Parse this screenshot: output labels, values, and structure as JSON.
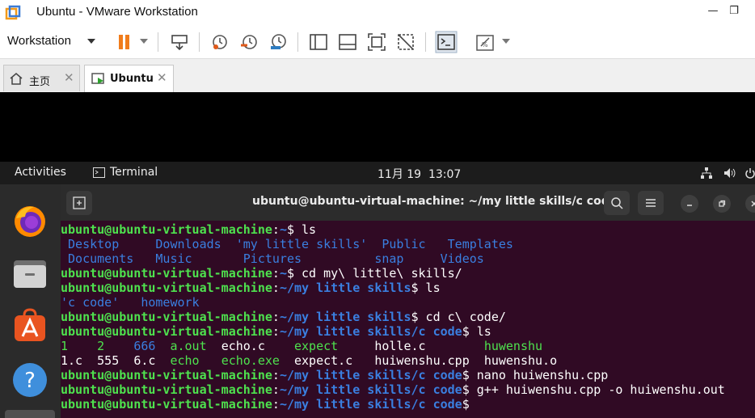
{
  "window": {
    "title": "Ubuntu - VMware Workstation"
  },
  "toolbar": {
    "menu_label": "Workstation"
  },
  "tabs": [
    {
      "label": "主页"
    },
    {
      "label": "Ubuntu"
    }
  ],
  "ubuntu_topbar": {
    "activities": "Activities",
    "app": "Terminal",
    "datetime": "11月 19  13:07"
  },
  "terminal": {
    "title": "ubuntu@ubuntu-virtual-machine: ~/my little skills/c code",
    "lines": [
      {
        "user": "ubuntu@ubuntu-virtual-machine",
        "sep": ":",
        "path": "~",
        "cmd": "$ ls"
      },
      {
        "out": [
          {
            "t": " Desktop     ",
            "c": "blue"
          },
          {
            "t": "Downloads  ",
            "c": "blue"
          },
          {
            "t": "'my little skills'  ",
            "c": "blue"
          },
          {
            "t": "Public   ",
            "c": "blue"
          },
          {
            "t": "Templates",
            "c": "blue"
          }
        ]
      },
      {
        "out": [
          {
            "t": " Documents   ",
            "c": "blue"
          },
          {
            "t": "Music      ",
            "c": "blue"
          },
          {
            "t": " Pictures          ",
            "c": "blue"
          },
          {
            "t": "snap     ",
            "c": "blue"
          },
          {
            "t": "Videos",
            "c": "blue"
          }
        ]
      },
      {
        "user": "ubuntu@ubuntu-virtual-machine",
        "sep": ":",
        "path": "~",
        "cmd": "$ cd my\\ little\\ skills/"
      },
      {
        "user": "ubuntu@ubuntu-virtual-machine",
        "sep": ":",
        "path": "~/my little skills",
        "cmd": "$ ls"
      },
      {
        "out": [
          {
            "t": "'c code'   ",
            "c": "blue"
          },
          {
            "t": "homework",
            "c": "blue"
          }
        ]
      },
      {
        "user": "ubuntu@ubuntu-virtual-machine",
        "sep": ":",
        "path": "~/my little skills",
        "cmd": "$ cd c\\ code/"
      },
      {
        "user": "ubuntu@ubuntu-virtual-machine",
        "sep": ":",
        "path": "~/my little skills/c code",
        "cmd": "$ ls"
      },
      {
        "out": [
          {
            "t": "1    ",
            "c": "green"
          },
          {
            "t": "2    ",
            "c": "green"
          },
          {
            "t": "666  ",
            "c": "blue"
          },
          {
            "t": "a.out  ",
            "c": "green"
          },
          {
            "t": "echo.c    ",
            "c": "white"
          },
          {
            "t": "expect     ",
            "c": "green"
          },
          {
            "t": "holle.c        ",
            "c": "white"
          },
          {
            "t": "huwenshu",
            "c": "green"
          }
        ]
      },
      {
        "out": [
          {
            "t": "1.c  ",
            "c": "white"
          },
          {
            "t": "555  ",
            "c": "white"
          },
          {
            "t": "6.c  ",
            "c": "white"
          },
          {
            "t": "echo   ",
            "c": "green"
          },
          {
            "t": "echo.exe  ",
            "c": "green"
          },
          {
            "t": "expect.c   ",
            "c": "white"
          },
          {
            "t": "huiwenshu.cpp  ",
            "c": "white"
          },
          {
            "t": "huwenshu.o",
            "c": "white"
          }
        ]
      },
      {
        "user": "ubuntu@ubuntu-virtual-machine",
        "sep": ":",
        "path": "~/my little skills/c code",
        "cmd": "$ nano huiwenshu.cpp"
      },
      {
        "user": "ubuntu@ubuntu-virtual-machine",
        "sep": ":",
        "path": "~/my little skills/c code",
        "cmd": "$ g++ huiwenshu.cpp -o huiwenshu.out"
      },
      {
        "user": "ubuntu@ubuntu-virtual-machine",
        "sep": ":",
        "path": "~/my little skills/c code",
        "cmd": "$ "
      }
    ]
  },
  "colors": {
    "terminal_bg": "#300a24",
    "prompt_green": "#4ee24e",
    "path_blue": "#3a7fe0"
  }
}
